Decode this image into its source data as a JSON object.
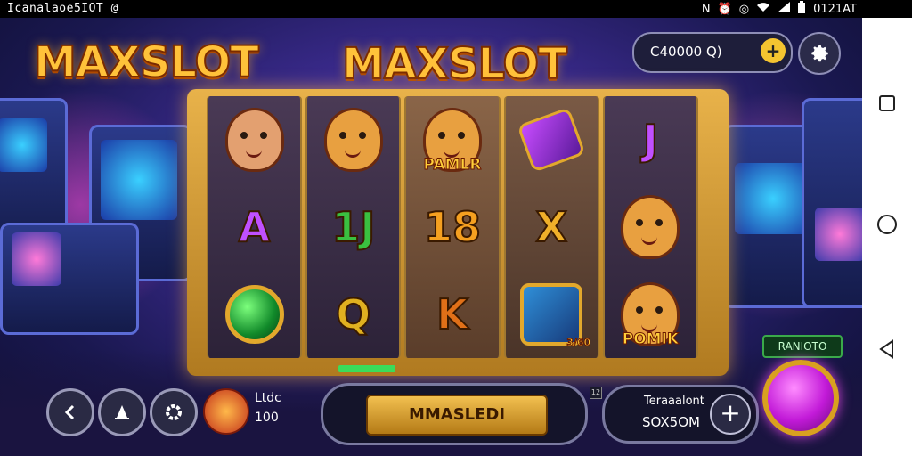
{
  "status_bar": {
    "left_text": "Icanalaoe5IOT @",
    "time": "0121AT",
    "icons": [
      "nfc-icon",
      "alarm-icon",
      "vibrate-icon",
      "wifi-icon",
      "signal-icon",
      "battery-icon"
    ]
  },
  "titles": {
    "left": "MAXSLOT",
    "center": "MAXSLOT"
  },
  "balance": {
    "value": "C40000 Q)",
    "add_label": "+"
  },
  "reels": [
    [
      {
        "kind": "woman-portrait",
        "caption": ""
      },
      {
        "kind": "letter",
        "text": "A",
        "color": "#c050ff"
      },
      {
        "kind": "green-gem",
        "caption": ""
      }
    ],
    [
      {
        "kind": "cat-portrait",
        "caption": ""
      },
      {
        "kind": "letter",
        "text": "1J",
        "color": "#3ac040"
      },
      {
        "kind": "letter",
        "text": "Q",
        "color": "#e0b020"
      }
    ],
    [
      {
        "kind": "cat-portrait",
        "caption": "PAMLR"
      },
      {
        "kind": "letter",
        "text": "18",
        "color": "#f5a020"
      },
      {
        "kind": "letter",
        "text": "K",
        "color": "#e07018"
      }
    ],
    [
      {
        "kind": "potion",
        "caption": ""
      },
      {
        "kind": "letter",
        "text": "X",
        "color": "#f0b02a"
      },
      {
        "kind": "shield",
        "caption": "3/60"
      }
    ],
    [
      {
        "kind": "letter",
        "text": "J",
        "color": "#c050ff"
      },
      {
        "kind": "cat-portrait",
        "caption": ""
      },
      {
        "kind": "cat-portrait",
        "caption": "POMIK"
      }
    ]
  ],
  "controls": {
    "lines_label": "Ltdc",
    "lines_value": "100",
    "spin_label": "MMASLEDI",
    "total_label": "Teraaalont",
    "total_value": "SOX5OM",
    "total_plus": "+",
    "badge": "12",
    "autoplay_label": "RANIOTO"
  },
  "colors": {
    "accent": "#ffc23a",
    "spin_button": "#c21ad8",
    "background": "#2a1f6a"
  }
}
